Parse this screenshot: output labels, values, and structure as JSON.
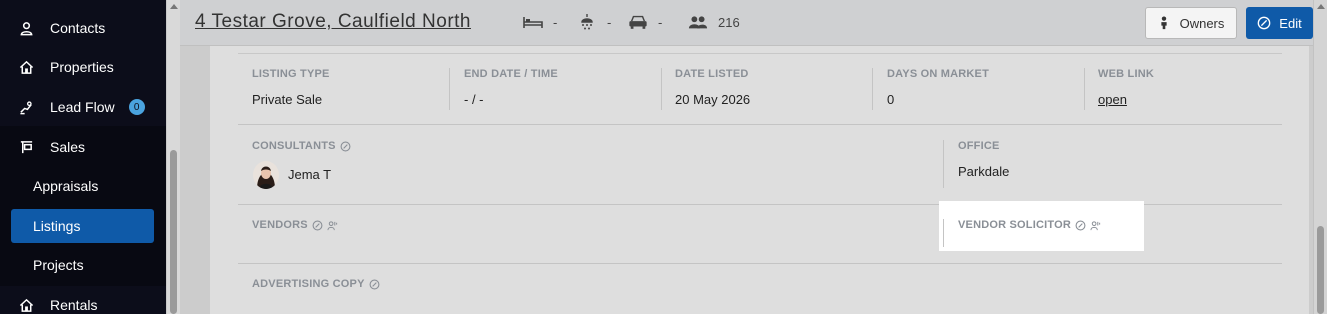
{
  "sidebar": {
    "items": [
      {
        "label": "Contacts",
        "icon": "person-icon"
      },
      {
        "label": "Properties",
        "icon": "house-icon"
      },
      {
        "label": "Lead Flow",
        "icon": "hand-icon",
        "badge": "0"
      },
      {
        "label": "Sales",
        "icon": "sign-icon"
      },
      {
        "label": "Rentals",
        "icon": "house-icon"
      }
    ],
    "sub_items": [
      {
        "label": "Appraisals"
      },
      {
        "label": "Listings",
        "active": true
      },
      {
        "label": "Projects"
      }
    ]
  },
  "header": {
    "title": "4 Testar Grove, Caulfield North",
    "beds": "-",
    "baths": "-",
    "cars": "-",
    "contacts_count": "216",
    "owners_label": "Owners",
    "edit_label": "Edit"
  },
  "details": {
    "listing_type": {
      "label": "LISTING TYPE",
      "value": "Private Sale"
    },
    "end_date": {
      "label": "END DATE / TIME",
      "value": "- / -"
    },
    "date_listed": {
      "label": "DATE LISTED",
      "value": "20 May 2026"
    },
    "days_on_market": {
      "label": "DAYS ON MARKET",
      "value": "0"
    },
    "web_link": {
      "label": "WEB LINK",
      "value": "open"
    },
    "consultants": {
      "label": "CONSULTANTS",
      "name": "Jema T"
    },
    "office": {
      "label": "OFFICE",
      "value": "Parkdale"
    },
    "vendors": {
      "label": "VENDORS"
    },
    "vendor_solicitor": {
      "label": "VENDOR SOLICITOR"
    },
    "advertising_copy": {
      "label": "ADVERTISING COPY"
    }
  },
  "colors": {
    "sidebar_bg": "#0c0d1a",
    "accent": "#0f5aa8",
    "badge": "#4aa3df"
  }
}
